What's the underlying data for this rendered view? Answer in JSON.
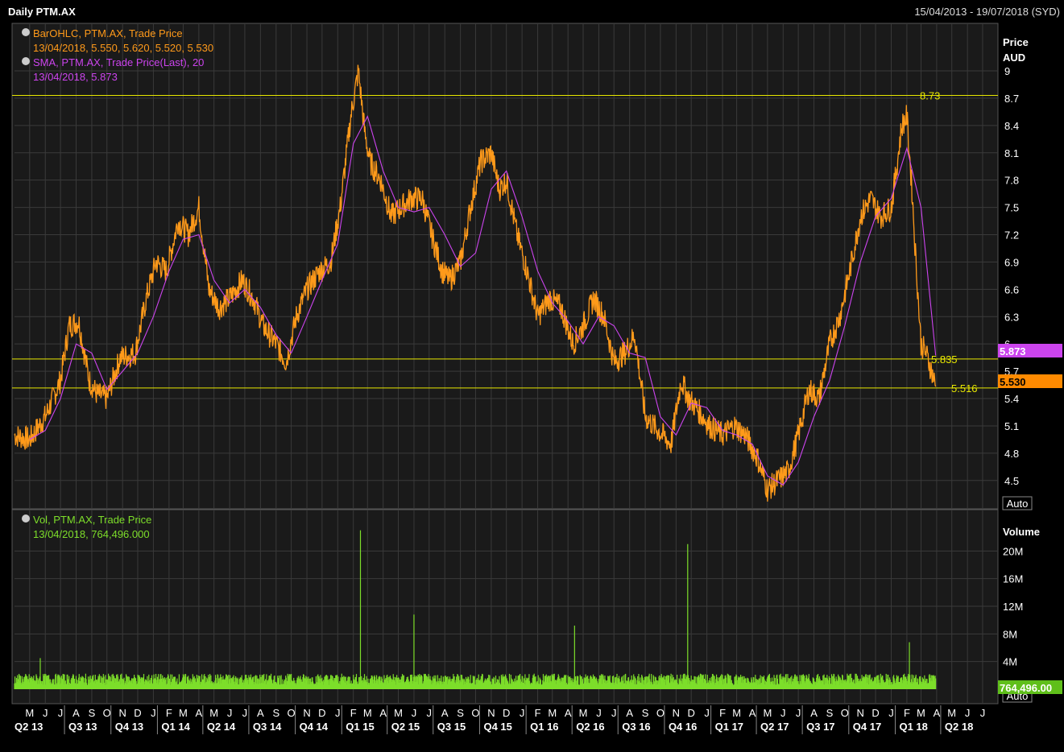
{
  "window": {
    "title": "Daily PTM.AX",
    "date_range": "15/04/2013 - 19/07/2018 (SYD)"
  },
  "colors": {
    "background": "#000000",
    "panel_bg": "#1a1a1a",
    "grid": "#3a3a3a",
    "price": "#ff9a1a",
    "sma": "#cc44ee",
    "volume": "#7dde2a",
    "hline": "#e8e800",
    "axis_text": "#ffffff"
  },
  "legend": {
    "price_icon": "circle-clock-icon",
    "price_line1": "BarOHLC, PTM.AX, Trade Price",
    "price_line2": "13/04/2018, 5.550, 5.620, 5.520, 5.530",
    "sma_line1": "SMA, PTM.AX, Trade Price(Last),  20",
    "sma_line2": "13/04/2018, 5.873",
    "vol_line1": "Vol, PTM.AX, Trade Price",
    "vol_line2": "13/04/2018, 764,496.000"
  },
  "price_axis": {
    "title1": "Price",
    "title2": "AUD",
    "auto_label": "Auto",
    "last_price_label": "5.530",
    "last_sma_label": "5.873",
    "ticks": [
      "9",
      "8.7",
      "8.4",
      "8.1",
      "7.8",
      "7.5",
      "7.2",
      "6.9",
      "6.6",
      "6.3",
      "6",
      "5.7",
      "5.4",
      "5.1",
      "4.8",
      "4.5"
    ]
  },
  "volume_axis": {
    "title": "Volume",
    "auto_label": "Auto",
    "last_volume_label": "764,496.00",
    "ticks": [
      "20M",
      "16M",
      "12M",
      "8M",
      "4M"
    ]
  },
  "horizontal_lines": [
    {
      "value": 8.73,
      "label": "8.73"
    },
    {
      "value": 5.835,
      "label": "5.835"
    },
    {
      "value": 5.516,
      "label": "5.516"
    }
  ],
  "x_axis": {
    "months": [
      "M",
      "J",
      "J",
      "A",
      "S",
      "O",
      "N",
      "D",
      "J",
      "F",
      "M",
      "A",
      "M",
      "J",
      "J",
      "A",
      "S",
      "O",
      "N",
      "D",
      "J",
      "F",
      "M",
      "A",
      "M",
      "J",
      "J",
      "A",
      "S",
      "O",
      "N",
      "D",
      "J",
      "F",
      "M",
      "A",
      "M",
      "J",
      "J",
      "A",
      "S",
      "O",
      "N",
      "D",
      "J",
      "F",
      "M",
      "A",
      "M",
      "J",
      "J",
      "A",
      "S",
      "O",
      "N",
      "D",
      "J",
      "F",
      "M",
      "A",
      "M",
      "J",
      "J"
    ],
    "quarters": [
      "Q2 13",
      "Q3 13",
      "Q4 13",
      "Q1 14",
      "Q2 14",
      "Q3 14",
      "Q4 14",
      "Q1 15",
      "Q2 15",
      "Q3 15",
      "Q4 15",
      "Q1 16",
      "Q2 16",
      "Q3 16",
      "Q4 16",
      "Q1 17",
      "Q2 17",
      "Q3 17",
      "Q4 17",
      "Q1 18",
      "Q2 18"
    ]
  },
  "chart_data": {
    "type": "line",
    "title": "Daily PTM.AX",
    "ylabel": "Price AUD",
    "ylim": [
      4.2,
      9.3
    ],
    "x_start": "2013-04-15",
    "x_end": "2018-07-19",
    "series": [
      {
        "name": "BarOHLC, PTM.AX, Trade Price",
        "x": [
          "2013-04-15",
          "2013-05-15",
          "2013-06-15",
          "2013-07-15",
          "2013-08-01",
          "2013-08-20",
          "2013-09-10",
          "2013-09-25",
          "2013-10-15",
          "2013-11-10",
          "2013-12-10",
          "2014-01-01",
          "2014-01-20",
          "2014-02-10",
          "2014-03-05",
          "2014-03-25",
          "2014-04-15",
          "2014-05-05",
          "2014-05-25",
          "2014-06-15",
          "2014-07-10",
          "2014-08-01",
          "2014-08-20",
          "2014-09-15",
          "2014-10-05",
          "2014-10-25",
          "2014-11-15",
          "2014-12-10",
          "2015-01-01",
          "2015-01-20",
          "2015-02-10",
          "2015-02-25",
          "2015-03-10",
          "2015-03-20",
          "2015-04-10",
          "2015-05-01",
          "2015-05-20",
          "2015-06-10",
          "2015-07-01",
          "2015-07-20",
          "2015-08-10",
          "2015-08-25",
          "2015-09-15",
          "2015-10-05",
          "2015-10-25",
          "2015-11-15",
          "2015-12-01",
          "2015-12-15",
          "2016-01-05",
          "2016-01-25",
          "2016-02-15",
          "2016-03-10",
          "2016-04-01",
          "2016-04-25",
          "2016-05-15",
          "2016-06-05",
          "2016-06-25",
          "2016-07-15",
          "2016-08-05",
          "2016-08-25",
          "2016-09-15",
          "2016-10-10",
          "2016-11-05",
          "2016-11-25",
          "2016-12-10",
          "2016-12-25",
          "2017-01-20",
          "2017-02-15",
          "2017-03-10",
          "2017-04-01",
          "2017-04-25",
          "2017-05-15",
          "2017-06-05",
          "2017-06-25",
          "2017-07-15",
          "2017-08-05",
          "2017-08-25",
          "2017-09-15",
          "2017-10-05",
          "2017-10-25",
          "2017-11-15",
          "2017-12-05",
          "2017-12-25",
          "2018-01-15",
          "2018-01-25",
          "2018-02-05",
          "2018-02-15",
          "2018-02-25",
          "2018-03-05",
          "2018-03-15",
          "2018-03-25",
          "2018-04-05",
          "2018-04-13"
        ],
        "values": [
          5.0,
          4.95,
          5.2,
          5.6,
          6.2,
          6.25,
          5.6,
          5.45,
          5.4,
          5.85,
          5.9,
          6.5,
          6.9,
          6.8,
          7.35,
          7.2,
          7.5,
          6.6,
          6.4,
          6.5,
          6.7,
          6.5,
          6.2,
          6.0,
          5.8,
          6.3,
          6.6,
          6.8,
          6.9,
          7.5,
          8.5,
          9.0,
          8.3,
          8.0,
          7.8,
          7.4,
          7.5,
          7.6,
          7.6,
          7.2,
          6.8,
          6.7,
          6.9,
          7.5,
          8.0,
          8.1,
          7.7,
          7.8,
          7.2,
          6.8,
          6.3,
          6.5,
          6.4,
          6.0,
          6.2,
          6.5,
          6.3,
          5.8,
          5.9,
          6.1,
          5.2,
          5.05,
          4.9,
          5.6,
          5.4,
          5.3,
          5.1,
          5.0,
          5.1,
          5.0,
          4.75,
          4.4,
          4.5,
          4.6,
          5.0,
          5.5,
          5.4,
          6.0,
          6.3,
          6.8,
          7.4,
          7.6,
          7.4,
          7.5,
          7.9,
          8.4,
          8.5,
          7.7,
          6.9,
          6.0,
          5.9,
          5.7,
          5.53
        ]
      },
      {
        "name": "SMA, PTM.AX, Trade Price(Last),  20",
        "x": [
          "2013-05-15",
          "2013-06-15",
          "2013-07-15",
          "2013-08-15",
          "2013-09-15",
          "2013-10-15",
          "2013-11-15",
          "2013-12-15",
          "2014-01-15",
          "2014-02-15",
          "2014-03-15",
          "2014-04-15",
          "2014-05-15",
          "2014-06-15",
          "2014-07-15",
          "2014-08-15",
          "2014-09-15",
          "2014-10-15",
          "2014-11-15",
          "2014-12-15",
          "2015-01-15",
          "2015-02-15",
          "2015-03-15",
          "2015-04-15",
          "2015-05-15",
          "2015-06-15",
          "2015-07-15",
          "2015-08-15",
          "2015-09-15",
          "2015-10-15",
          "2015-11-15",
          "2015-12-15",
          "2016-01-15",
          "2016-02-15",
          "2016-03-15",
          "2016-04-15",
          "2016-05-15",
          "2016-06-15",
          "2016-07-15",
          "2016-08-15",
          "2016-09-15",
          "2016-10-15",
          "2016-11-15",
          "2016-12-15",
          "2017-01-15",
          "2017-02-15",
          "2017-03-15",
          "2017-04-15",
          "2017-05-15",
          "2017-06-15",
          "2017-07-15",
          "2017-08-15",
          "2017-09-15",
          "2017-10-15",
          "2017-11-15",
          "2017-12-15",
          "2018-01-15",
          "2018-02-15",
          "2018-03-15",
          "2018-04-13"
        ],
        "values": [
          4.95,
          5.05,
          5.4,
          6.0,
          5.9,
          5.5,
          5.7,
          5.9,
          6.3,
          6.8,
          7.15,
          7.2,
          6.7,
          6.45,
          6.6,
          6.4,
          6.1,
          5.9,
          6.3,
          6.7,
          7.1,
          8.2,
          8.5,
          7.9,
          7.5,
          7.45,
          7.5,
          7.2,
          6.85,
          7.0,
          7.7,
          7.9,
          7.4,
          6.8,
          6.45,
          6.25,
          6.0,
          6.3,
          6.2,
          5.9,
          5.85,
          5.2,
          5.0,
          5.35,
          5.3,
          5.05,
          5.0,
          4.9,
          4.55,
          4.45,
          4.7,
          5.2,
          5.6,
          6.2,
          6.9,
          7.4,
          7.6,
          8.15,
          7.5,
          5.873
        ]
      }
    ],
    "volume": {
      "name": "Vol, PTM.AX, Trade Price",
      "unit": "shares",
      "baseline_typical": 1500000,
      "spikes": [
        {
          "x": "2013-06-05",
          "value": 4500000
        },
        {
          "x": "2015-03-01",
          "value": 23000000
        },
        {
          "x": "2015-06-15",
          "value": 10800000
        },
        {
          "x": "2016-04-28",
          "value": 9200000
        },
        {
          "x": "2016-12-08",
          "value": 21000000
        },
        {
          "x": "2018-02-20",
          "value": 6800000
        }
      ],
      "last": {
        "x": "2018-04-13",
        "value": 764496
      }
    }
  }
}
